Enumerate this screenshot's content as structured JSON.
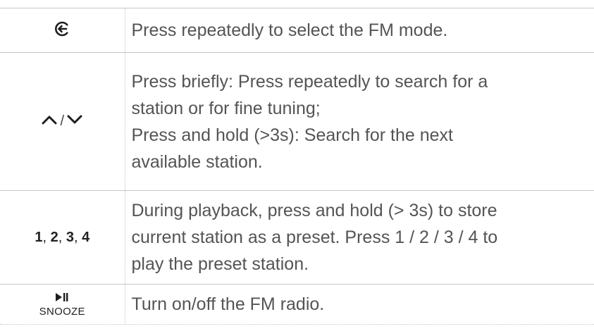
{
  "rows": [
    {
      "key": {
        "icon": "source-mode-icon"
      },
      "lines": [
        "Press repeatedly to select the FM mode."
      ]
    },
    {
      "key": {
        "icons": [
          "chevron-up-icon",
          "chevron-down-icon"
        ],
        "separator": "/"
      },
      "lines": [
        "Press briefly: Press repeatedly to search for a",
        "station or for fine tuning;",
        "Press and hold (>3s): Search for the next",
        "available station."
      ]
    },
    {
      "key": {
        "presets": [
          "1",
          "2",
          "3",
          "4"
        ],
        "comma": ","
      },
      "lines": [
        "During playback, press and hold (> 3s) to store",
        "current station as a preset. Press 1 / 2 / 3 / 4 to",
        "play the preset station."
      ]
    },
    {
      "key": {
        "icon": "play-pause-icon",
        "label": "SNOOZE"
      },
      "lines": [
        "Turn on/off the FM radio."
      ]
    }
  ]
}
